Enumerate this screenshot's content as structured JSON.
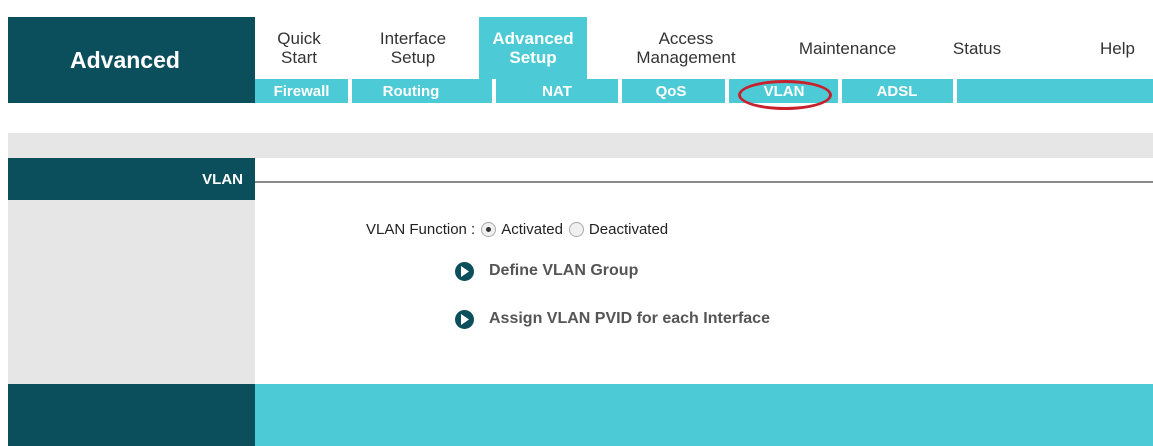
{
  "brand": {
    "label": "Advanced"
  },
  "topnav": {
    "tabs": [
      {
        "label": "Quick\nStart"
      },
      {
        "label": "Interface\nSetup"
      },
      {
        "label": "Advanced\nSetup",
        "active": true
      },
      {
        "label": "Access\nManagement"
      },
      {
        "label": "Maintenance"
      },
      {
        "label": "Status"
      },
      {
        "label": "Help"
      }
    ]
  },
  "subnav": {
    "items": [
      {
        "label": "Firewall"
      },
      {
        "label": "Routing"
      },
      {
        "label": "NAT"
      },
      {
        "label": "QoS"
      },
      {
        "label": "VLAN",
        "selected": true
      },
      {
        "label": "ADSL"
      }
    ]
  },
  "section": {
    "title": "VLAN"
  },
  "vlan_function": {
    "label": "VLAN Function :",
    "options": [
      "Activated",
      "Deactivated"
    ],
    "selected": "Activated"
  },
  "links": [
    {
      "label": "Define VLAN Group"
    },
    {
      "label": "Assign VLAN PVID for each Interface"
    }
  ],
  "colors": {
    "dark_teal": "#0c4f5c",
    "accent_cyan": "#4ccad5",
    "panel_gray": "#e6e6e6",
    "highlight_red": "#c8202c"
  }
}
